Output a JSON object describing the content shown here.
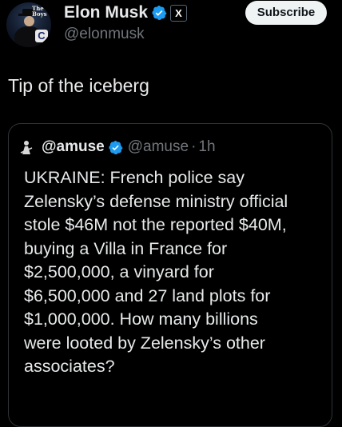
{
  "author": {
    "display_name": "Elon Musk",
    "handle": "@elonmusk",
    "avatar_text": "The Boys",
    "avatar_badge": "C",
    "verified_icon": "verified-badge-icon",
    "verified_color": "#1d9bf0",
    "affiliation_badge": "X"
  },
  "actions": {
    "subscribe_label": "Subscribe"
  },
  "post": {
    "text": "Tip of the iceberg"
  },
  "quote": {
    "name": "@amuse",
    "handle": "@amuse",
    "separator": "·",
    "time": "1h",
    "verified_icon": "verified-badge-icon",
    "lines": [
      "UKRAINE: French police say",
      "Zelensky’s defense ministry official",
      "stole $46M not the reported $40M,",
      "buying a Villa in France for",
      "$2,500,000, a vinyard for",
      "$6,500,000 and 27 land plots for",
      "$1,000,000. How many billions",
      "were looted by Zelensky’s other",
      "associates?"
    ]
  },
  "colors": {
    "background": "#000000",
    "text_primary": "#e7e9ea",
    "text_secondary": "#71767b",
    "border": "#2f3336",
    "button_bg": "#eff3f4"
  }
}
